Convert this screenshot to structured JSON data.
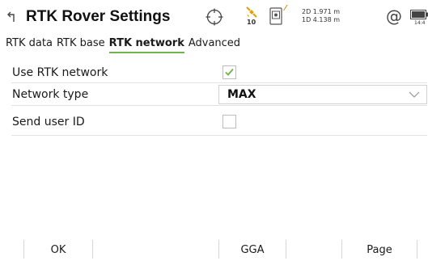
{
  "header": {
    "title": "RTK Rover Settings",
    "icons": [
      "back-arrow-icon",
      "target-crosshair-icon",
      "satellite-icon",
      "device-icon",
      "at-icon",
      "battery-icon"
    ],
    "satellite_count": "10",
    "precision_2d": "2D 1.971 m",
    "precision_1d": "1D 4.138 m",
    "battery_label": "14:4"
  },
  "tabs": [
    {
      "label": "RTK data",
      "active": false
    },
    {
      "label": "RTK base",
      "active": false
    },
    {
      "label": "RTK network",
      "active": true
    },
    {
      "label": "Advanced",
      "active": false
    }
  ],
  "form": {
    "use_rtk_network": {
      "label": "Use RTK network",
      "checked": true
    },
    "network_type": {
      "label": "Network type",
      "value": "MAX"
    },
    "send_user_id": {
      "label": "Send user ID",
      "checked": false
    }
  },
  "softkeys": {
    "f1": "OK",
    "f2": "",
    "f3": "GGA",
    "f4": "",
    "f5": "Page",
    "f6": ""
  },
  "colors": {
    "accent": "#6fb34f",
    "satellite_accent": "#e0a000"
  }
}
